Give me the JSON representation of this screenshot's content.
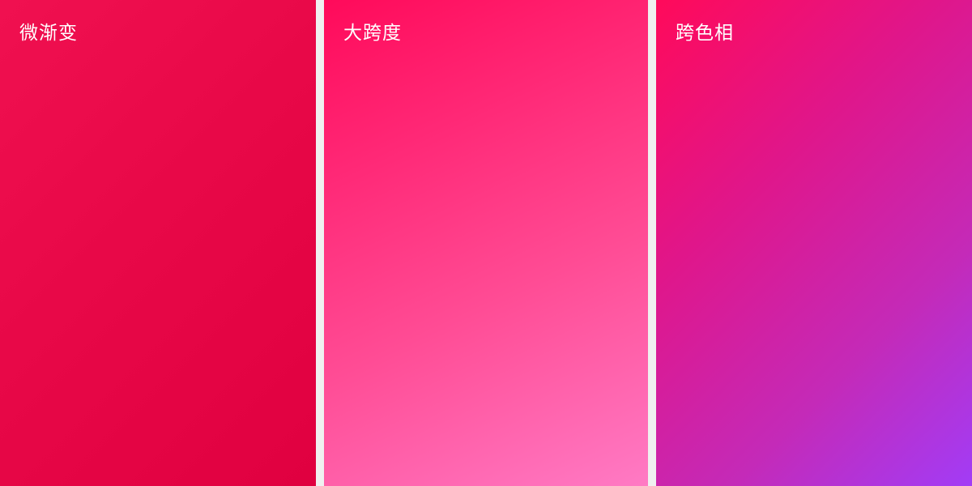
{
  "panels": [
    {
      "label": "微渐变",
      "colors": [
        "#f01050",
        "#e00040"
      ]
    },
    {
      "label": "大跨度",
      "colors": [
        "#ff0a5a",
        "#ff7ac4"
      ]
    },
    {
      "label": "跨色相",
      "colors": [
        "#ff0a5a",
        "#a23cf6"
      ]
    }
  ],
  "gap_color": "#f0f0f0",
  "label_color": "#ffffff"
}
